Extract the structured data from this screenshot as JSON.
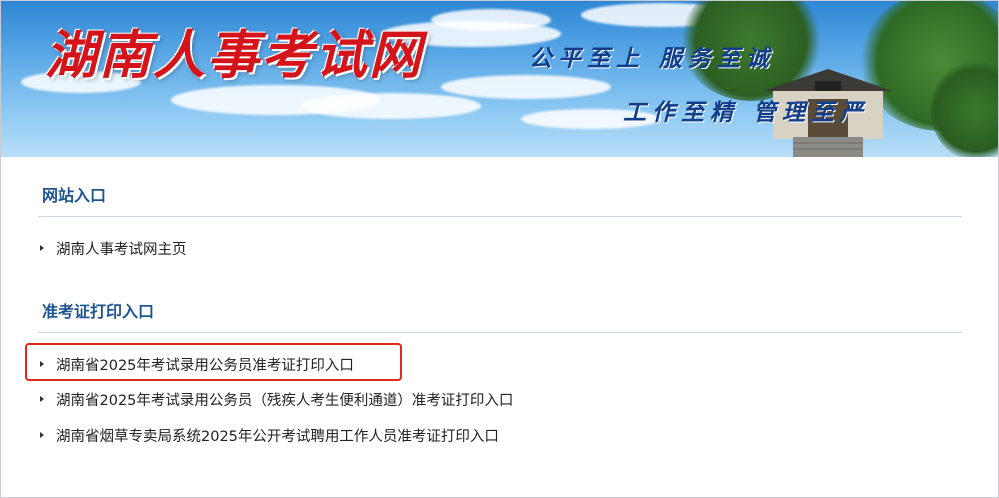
{
  "banner": {
    "site_title": "湖南人事考试网",
    "slogan_line1": "公平至上  服务至诚",
    "slogan_line2": "工作至精  管理至严",
    "title_color": "#d4141a",
    "slogan_color": "#123d8a"
  },
  "sections": [
    {
      "title": "网站入口",
      "links": [
        {
          "label": "湖南人事考试网主页"
        }
      ]
    },
    {
      "title": "准考证打印入口",
      "links": [
        {
          "label": "湖南省2025年考试录用公务员准考证打印入口",
          "highlighted": true
        },
        {
          "label": "湖南省2025年考试录用公务员（残疾人考生便利通道）准考证打印入口"
        },
        {
          "label": "湖南省烟草专卖局系统2025年公开考试聘用工作人员准考证打印入口"
        }
      ]
    }
  ],
  "colors": {
    "section_title": "#1f5592",
    "highlight_border": "#e0281e"
  }
}
